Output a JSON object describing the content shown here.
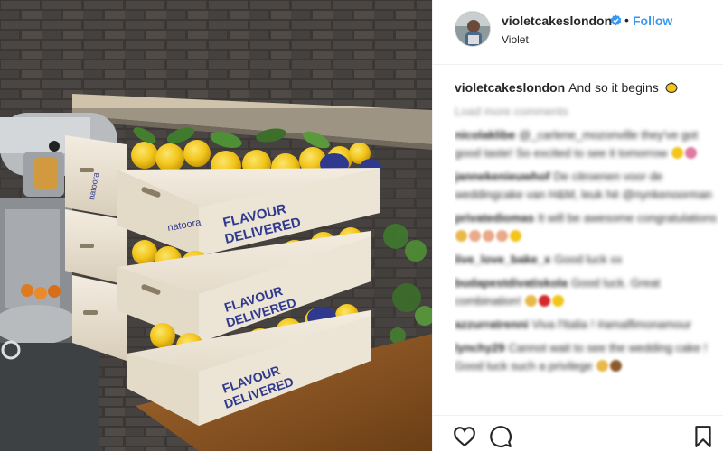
{
  "header": {
    "username": "violetcakeslondon",
    "separator": "•",
    "follow_label": "Follow",
    "subtitle": "Violet"
  },
  "caption": {
    "username": "violetcakeslondon",
    "text": "And so it begins",
    "emoji_icon": "lemon-emoji-icon"
  },
  "load_more": "Load more comments",
  "comments": [
    {
      "user": "nicolaklibe",
      "text": "@_carlene_mozonville they've got good taste! So excited to see it tomorrow"
    },
    {
      "user": "jannekenieuwhof",
      "text": "De citroenen voor de weddingcake van H&M, leuk hè @nynkenoorman"
    },
    {
      "user": "privatediomas",
      "text": "It will be awesome congratulations"
    },
    {
      "user": "live_love_bake_x",
      "text": "Good luck xx"
    },
    {
      "user": "budapestdivatiskola",
      "text": "Good luck. Great combination!"
    },
    {
      "user": "azzurratrenni",
      "text": "Viva l'Italia ! #amalfimonamour"
    },
    {
      "user": "lynchy29",
      "text": "Cannot wait to see the wedding cake ! Good luck such a privilege"
    }
  ],
  "photo": {
    "crate_text_line1": "FLAVOUR",
    "crate_text_line2": "DELIVERED",
    "crate_brand": "natoora"
  },
  "colors": {
    "link": "#3897f0",
    "verified": "#3897f0",
    "crate_text": "#2f3a8f",
    "lemon": "#f2c51b"
  },
  "icons": [
    "heart-icon",
    "comment-icon",
    "bookmark-icon",
    "verified-badge-icon"
  ]
}
